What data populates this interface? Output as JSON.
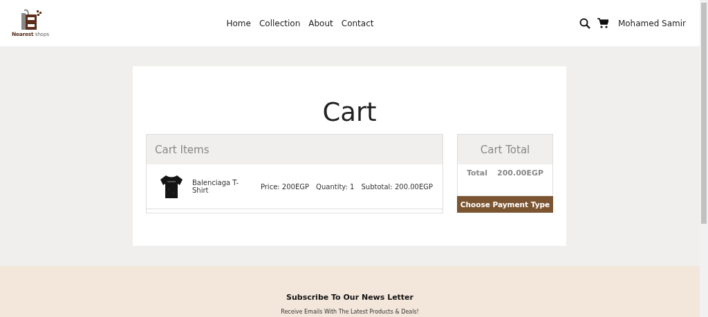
{
  "logo": {
    "brand": "Nearest",
    "suffix": "shops"
  },
  "nav": [
    {
      "label": "Home"
    },
    {
      "label": "Collection"
    },
    {
      "label": "About"
    },
    {
      "label": "Contact"
    }
  ],
  "user": {
    "name": "Mohamed Samir"
  },
  "page_title": "Cart",
  "cart_items": {
    "heading": "Cart Items",
    "items": [
      {
        "kind": "picture",
        "name": "Balenciaga T-Shirt",
        "price": "Price: 200EGP",
        "quantity": "Quantity: 1",
        "subtotal": "Subtotal: 200.00EGP"
      }
    ]
  },
  "cart_total": {
    "heading": "Cart Total",
    "label": "Total",
    "amount": "200.00EGP",
    "button": "Choose Payment Type"
  },
  "newsletter": {
    "title": "Subscribe To Our News Letter",
    "text": "Receive Emails With The Latest Products & Deals!"
  }
}
